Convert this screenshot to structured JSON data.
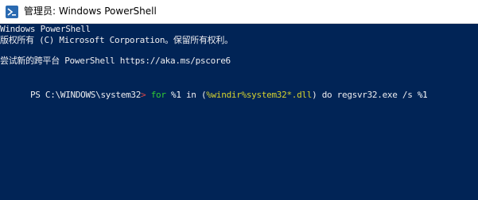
{
  "window": {
    "title": "管理员: Windows PowerShell",
    "icon": "powershell-icon",
    "background_color": "#012456",
    "foreground_color": "#eeedf0"
  },
  "console": {
    "banner_line1": "Windows PowerShell",
    "banner_line2": "版权所有 (C) Microsoft Corporation。保留所有权利。",
    "banner_line3": "尝试新的跨平台 PowerShell https://aka.ms/pscore6",
    "prompt": "PS C:\\WINDOWS\\system32",
    "prompt_arrow": ">",
    "command_tokens": [
      {
        "text": " ",
        "kind": "plain"
      },
      {
        "text": "for",
        "kind": "keyword"
      },
      {
        "text": " ",
        "kind": "plain"
      },
      {
        "text": "%1",
        "kind": "var"
      },
      {
        "text": " in (",
        "kind": "plain"
      },
      {
        "text": "%windir%system32*.dll",
        "kind": "string"
      },
      {
        "text": ") do regsvr32.exe /s ",
        "kind": "plain"
      },
      {
        "text": "%1",
        "kind": "var"
      }
    ],
    "colors": {
      "keyword": "#32cd32",
      "string": "#d6d22e",
      "prompt_arrow": "#e04848"
    }
  }
}
